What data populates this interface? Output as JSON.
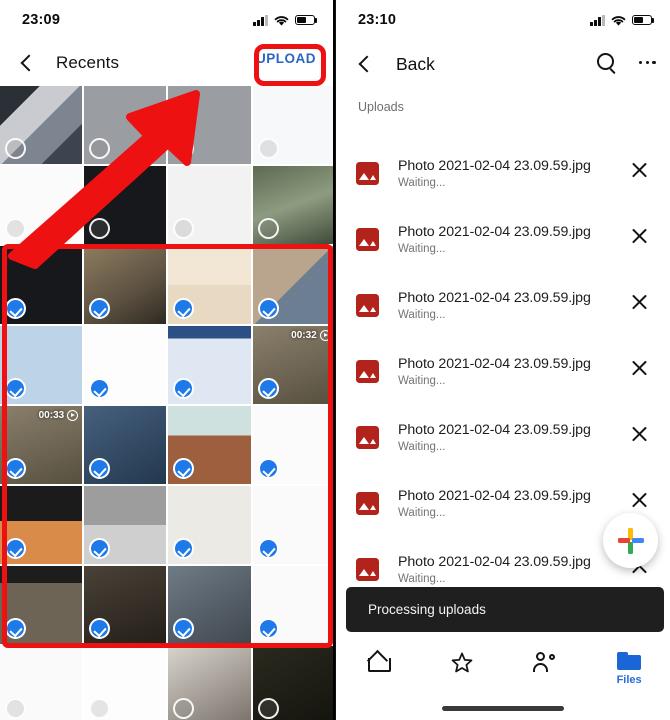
{
  "left": {
    "status": {
      "time": "23:09",
      "signal_icon": "signal-bars-icon",
      "wifi_icon": "wifi-icon",
      "battery_icon": "battery-icon"
    },
    "appbar": {
      "back_icon": "chevron-left-icon",
      "title": "Recents",
      "upload_label": "UPLOAD"
    },
    "annotation": {
      "upload_highlight_color": "#ee1111",
      "arrow_color": "#ee1111",
      "selection_highlight_color": "#ee1111"
    },
    "grid": {
      "selected_check_color": "#1d7ae8",
      "rows": [
        {
          "cells": [
            {
              "selected": false,
              "kind": "screenshot-collage",
              "duration": ""
            },
            {
              "selected": false,
              "kind": "empty-folder-gray",
              "duration": ""
            },
            {
              "selected": false,
              "kind": "empty-folder-gray",
              "duration": ""
            },
            {
              "selected": false,
              "kind": "empty-folder-white",
              "duration": ""
            }
          ]
        },
        {
          "cells": [
            {
              "selected": false,
              "kind": "file-list",
              "duration": ""
            },
            {
              "selected": false,
              "kind": "tweet-dark",
              "duration": ""
            },
            {
              "selected": false,
              "kind": "doodle-bw",
              "duration": ""
            },
            {
              "selected": false,
              "kind": "photo-outdoors",
              "duration": ""
            }
          ]
        },
        {
          "cells": [
            {
              "selected": true,
              "kind": "tweet-dark",
              "duration": ""
            },
            {
              "selected": true,
              "kind": "meme-rat",
              "duration": ""
            },
            {
              "selected": true,
              "kind": "comic-panels",
              "duration": ""
            },
            {
              "selected": true,
              "kind": "photo-collage",
              "duration": ""
            }
          ]
        },
        {
          "cells": [
            {
              "selected": true,
              "kind": "illustration-hands",
              "duration": ""
            },
            {
              "selected": true,
              "kind": "tweet-light",
              "duration": ""
            },
            {
              "selected": true,
              "kind": "screenshot-ui",
              "duration": ""
            },
            {
              "selected": true,
              "kind": "video",
              "duration": "00:32"
            }
          ]
        },
        {
          "cells": [
            {
              "selected": true,
              "kind": "video",
              "duration": "00:33"
            },
            {
              "selected": true,
              "kind": "app-folder",
              "duration": ""
            },
            {
              "selected": true,
              "kind": "meme-dolls",
              "duration": ""
            },
            {
              "selected": true,
              "kind": "text-post",
              "duration": ""
            }
          ]
        },
        {
          "cells": [
            {
              "selected": true,
              "kind": "chat-birds",
              "duration": ""
            },
            {
              "selected": true,
              "kind": "comic-bw",
              "duration": ""
            },
            {
              "selected": true,
              "kind": "poster-text",
              "duration": ""
            },
            {
              "selected": true,
              "kind": "article-text",
              "duration": ""
            }
          ]
        },
        {
          "cells": [
            {
              "selected": true,
              "kind": "meme-caption",
              "duration": ""
            },
            {
              "selected": true,
              "kind": "meme-video-caption",
              "duration": ""
            },
            {
              "selected": true,
              "kind": "photo-crowd",
              "duration": ""
            },
            {
              "selected": true,
              "kind": "chat-light",
              "duration": ""
            }
          ]
        },
        {
          "cells": [
            {
              "selected": false,
              "kind": "chat-light",
              "duration": ""
            },
            {
              "selected": false,
              "kind": "tweet-light",
              "duration": ""
            },
            {
              "selected": false,
              "kind": "photo-room",
              "duration": ""
            },
            {
              "selected": false,
              "kind": "meme-dark",
              "duration": ""
            }
          ]
        }
      ]
    }
  },
  "right": {
    "status": {
      "time": "23:10",
      "signal_icon": "signal-bars-icon",
      "wifi_icon": "wifi-icon",
      "battery_icon": "battery-icon"
    },
    "appbar": {
      "back_icon": "chevron-left-icon",
      "title": "Back",
      "search_icon": "search-icon",
      "more_icon": "more-options-icon"
    },
    "section_header": "Uploads",
    "uploads": [
      {
        "name": "Photo 2021-02-04 23.09.59.jpg",
        "status": "Waiting...",
        "icon": "image-file-icon",
        "cancel_icon": "close-icon"
      },
      {
        "name": "Photo 2021-02-04 23.09.59.jpg",
        "status": "Waiting...",
        "icon": "image-file-icon",
        "cancel_icon": "close-icon"
      },
      {
        "name": "Photo 2021-02-04 23.09.59.jpg",
        "status": "Waiting...",
        "icon": "image-file-icon",
        "cancel_icon": "close-icon"
      },
      {
        "name": "Photo 2021-02-04 23.09.59.jpg",
        "status": "Waiting...",
        "icon": "image-file-icon",
        "cancel_icon": "close-icon"
      },
      {
        "name": "Photo 2021-02-04 23.09.59.jpg",
        "status": "Waiting...",
        "icon": "image-file-icon",
        "cancel_icon": "close-icon"
      },
      {
        "name": "Photo 2021-02-04 23.09.59.jpg",
        "status": "Waiting...",
        "icon": "image-file-icon",
        "cancel_icon": "close-icon"
      },
      {
        "name": "Photo 2021-02-04 23.09.59.jpg",
        "status": "Waiting...",
        "icon": "image-file-icon",
        "cancel_icon": "close-icon"
      }
    ],
    "fab": {
      "icon": "google-plus-add-icon",
      "colors": [
        "#4285f4",
        "#ea4335",
        "#fbbc05",
        "#34a853"
      ]
    },
    "snackbar": {
      "message": "Processing uploads",
      "background": "#1f1f1f"
    },
    "bottom_nav": {
      "active_color": "#2a6ad6",
      "items": [
        {
          "label": "",
          "icon": "home-icon",
          "active": false
        },
        {
          "label": "",
          "icon": "star-icon",
          "active": false
        },
        {
          "label": "",
          "icon": "shared-people-icon",
          "active": false
        },
        {
          "label": "Files",
          "icon": "folder-icon",
          "active": true
        }
      ]
    }
  }
}
